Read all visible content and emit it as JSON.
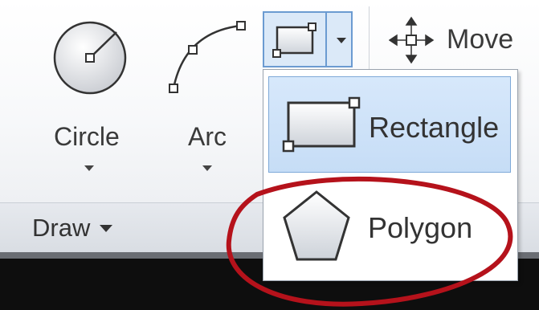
{
  "ribbon": {
    "tools": {
      "circle": {
        "label": "Circle",
        "icon": "circle-tool-icon"
      },
      "arc": {
        "label": "Arc",
        "icon": "arc-tool-icon"
      },
      "rectangle_split": {
        "icon": "rectangle-tool-icon",
        "dropdown_icon": "chevron-down-icon"
      },
      "move": {
        "label": "Move",
        "icon": "move-arrows-icon"
      }
    },
    "panel": {
      "title": "Draw",
      "dropdown_icon": "caret-down-icon"
    }
  },
  "dropdown_menu": {
    "items": [
      {
        "label": "Rectangle",
        "icon": "rectangle-icon",
        "selected": true
      },
      {
        "label": "Polygon",
        "icon": "pentagon-icon",
        "selected": false
      }
    ]
  },
  "annotation": {
    "shape": "ellipse",
    "color": "#b5121b",
    "encircles": "Polygon"
  },
  "colors": {
    "highlight": "#c6ddf6",
    "highlight_border": "#7ea9d8",
    "annotation": "#b5121b"
  }
}
